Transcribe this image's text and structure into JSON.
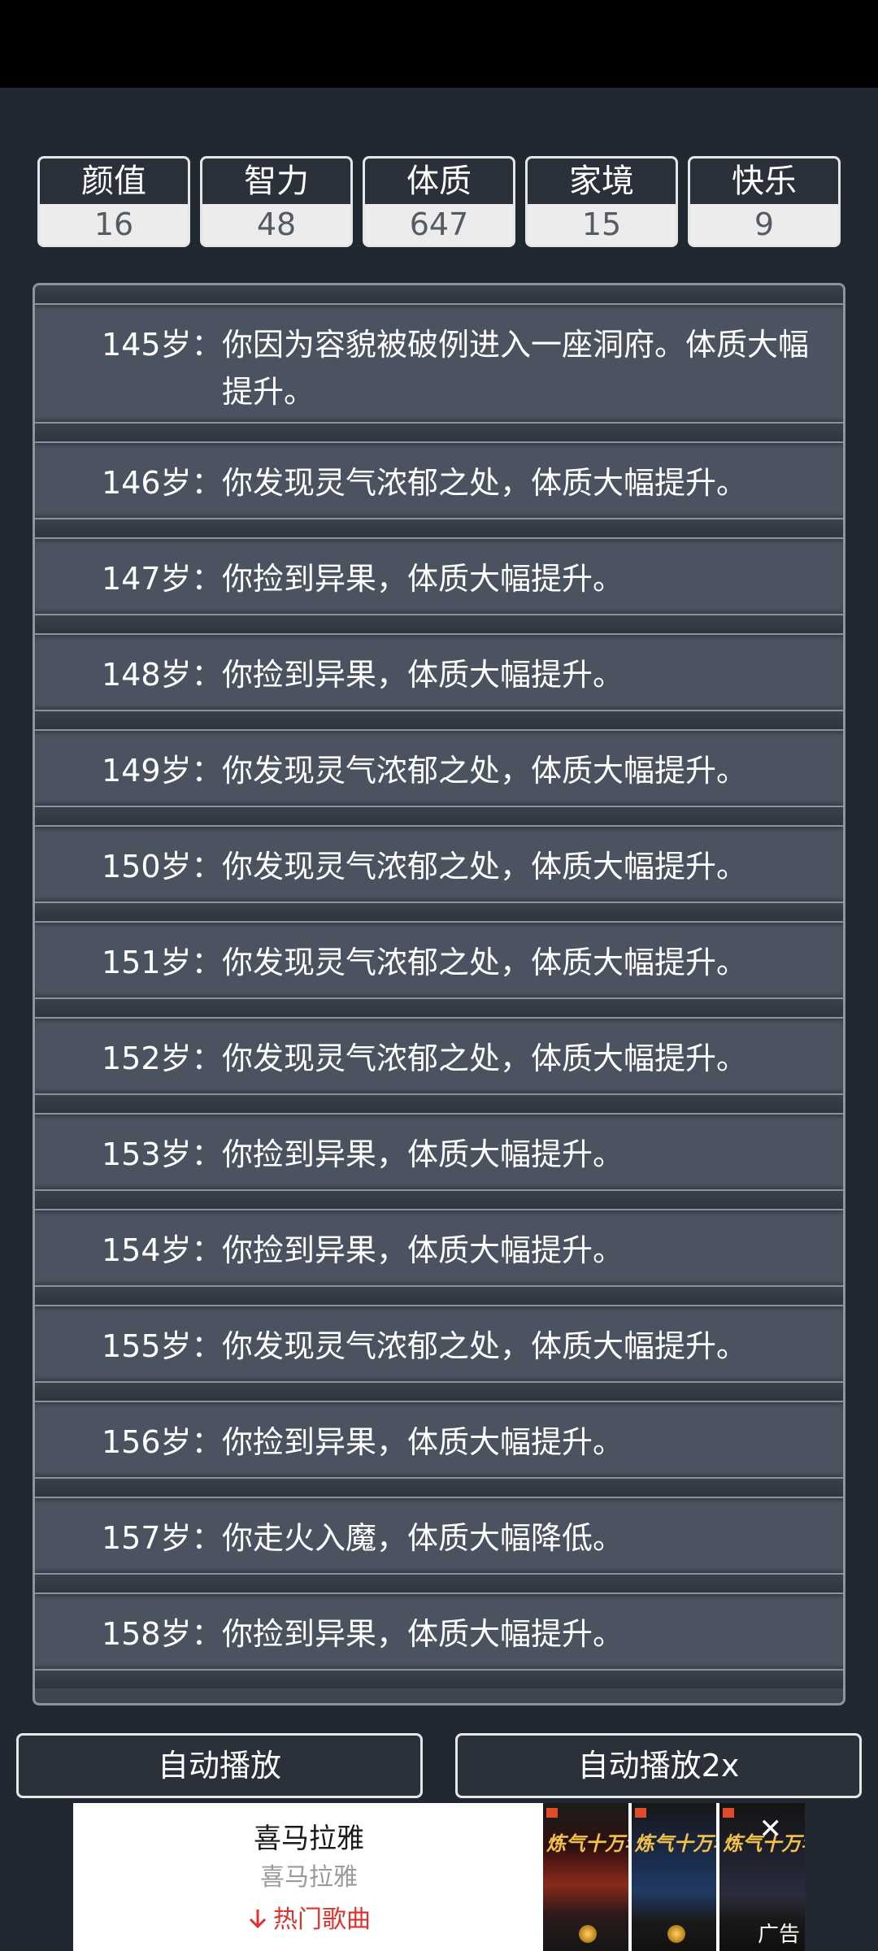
{
  "stats": [
    {
      "label": "颜值",
      "value": "16"
    },
    {
      "label": "智力",
      "value": "48"
    },
    {
      "label": "体质",
      "value": "647"
    },
    {
      "label": "家境",
      "value": "15"
    },
    {
      "label": "快乐",
      "value": "9"
    }
  ],
  "events": [
    {
      "age": "145岁：",
      "text": "你因为容貌被破例进入一座洞府。体质大幅提升。"
    },
    {
      "age": "146岁：",
      "text": "你发现灵气浓郁之处，体质大幅提升。"
    },
    {
      "age": "147岁：",
      "text": "你捡到异果，体质大幅提升。"
    },
    {
      "age": "148岁：",
      "text": "你捡到异果，体质大幅提升。"
    },
    {
      "age": "149岁：",
      "text": "你发现灵气浓郁之处，体质大幅提升。"
    },
    {
      "age": "150岁：",
      "text": "你发现灵气浓郁之处，体质大幅提升。"
    },
    {
      "age": "151岁：",
      "text": "你发现灵气浓郁之处，体质大幅提升。"
    },
    {
      "age": "152岁：",
      "text": "你发现灵气浓郁之处，体质大幅提升。"
    },
    {
      "age": "153岁：",
      "text": "你捡到异果，体质大幅提升。"
    },
    {
      "age": "154岁：",
      "text": "你捡到异果，体质大幅提升。"
    },
    {
      "age": "155岁：",
      "text": "你发现灵气浓郁之处，体质大幅提升。"
    },
    {
      "age": "156岁：",
      "text": "你捡到异果，体质大幅提升。"
    },
    {
      "age": "157岁：",
      "text": "你走火入魔，体质大幅降低。"
    },
    {
      "age": "158岁：",
      "text": "你捡到异果，体质大幅提升。"
    }
  ],
  "buttons": {
    "auto_play": "自动播放",
    "auto_play_2x": "自动播放2x"
  },
  "ad": {
    "title": "喜马拉雅",
    "subtitle": "喜马拉雅",
    "link": "热门歌曲",
    "thumb_title": "炼气十万年",
    "close": "✕",
    "badge": "广告"
  },
  "icons": {
    "download": "download-icon",
    "close": "close-icon"
  }
}
